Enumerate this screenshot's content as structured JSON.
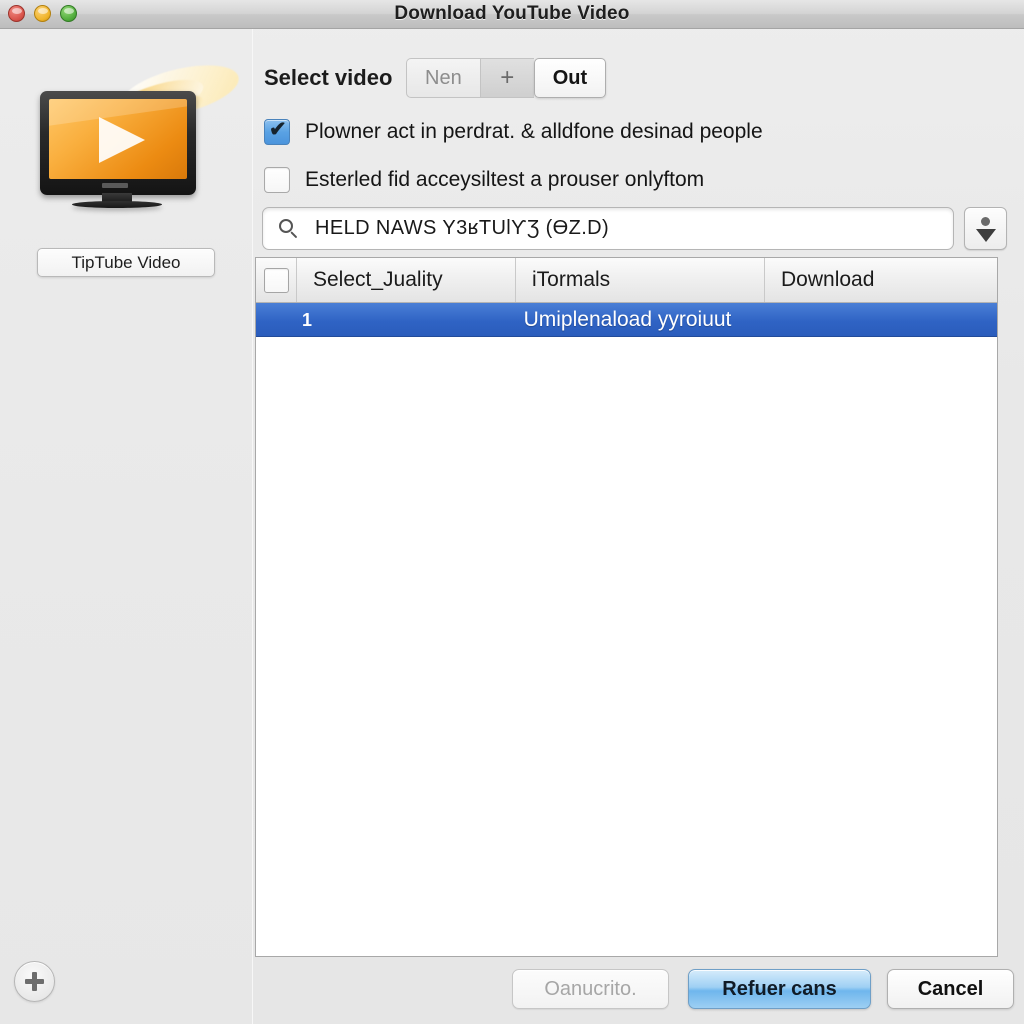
{
  "window": {
    "title": "Download YouTube Video",
    "traffic_lights": [
      {
        "name": "close",
        "color": "#d9544b"
      },
      {
        "name": "minimize",
        "color": "#f0b429"
      },
      {
        "name": "maximize",
        "color": "#51ad3c"
      }
    ]
  },
  "sidebar": {
    "app_icon": "tv-play-icon",
    "app_label": "TipTube Video",
    "add_button_icon": "plus-icon"
  },
  "main": {
    "select_label": "Select video",
    "segmented": [
      {
        "label": "Nen",
        "state": "disabled"
      },
      {
        "label": "+",
        "state": "normal"
      },
      {
        "label": "Out",
        "state": "selected"
      }
    ],
    "checkboxes": [
      {
        "label": "Plowner act in perdrat. & alldfone desinad people",
        "checked": true
      },
      {
        "label": "Esterled fid acceysiltest a prouser onlyftom",
        "checked": false
      }
    ],
    "search": {
      "icon": "search-icon",
      "value": "HELD NAWS Y3ʁTUƖƳƷ (ƟZ.D)",
      "placeholder": "",
      "stepper_icon": "stepper-updown-icon"
    },
    "table": {
      "select_all_checked": false,
      "columns": [
        "Select_Juality",
        "iTormals",
        "Download"
      ],
      "rows": [
        {
          "index": "1",
          "title": "Umiplenaload yyroiuut",
          "selected": true
        }
      ]
    }
  },
  "footer": {
    "buttons": [
      {
        "label": "Oanucrito.",
        "state": "disabled"
      },
      {
        "label": "Refuer cans",
        "state": "default"
      },
      {
        "label": "Cancel",
        "state": "normal"
      }
    ]
  },
  "colors": {
    "selection_blue": "#2f63c4",
    "window_bg": "#eaeaea",
    "default_button_blue": "#9fd0f4"
  }
}
